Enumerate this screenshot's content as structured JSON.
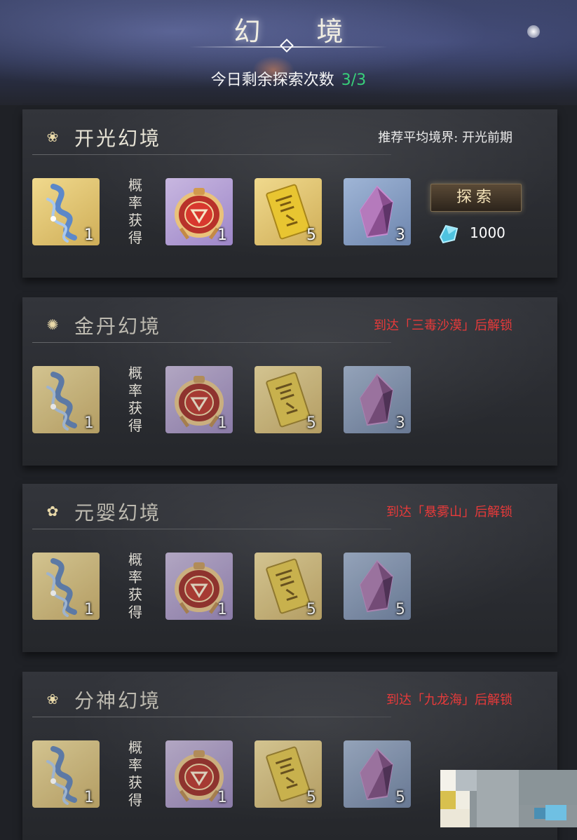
{
  "header": {
    "title": "幻 境",
    "explore_label": "今日剩余探索次数",
    "explore_value": "3/3"
  },
  "realms": [
    {
      "name": "开光幻境",
      "note": "推荐平均境界: 开光前期",
      "locked": false,
      "prob_label": "概率获得",
      "first_reward_count": "1",
      "drops": [
        "1",
        "5",
        "3"
      ],
      "explore_button": "探索",
      "cost": "1000"
    },
    {
      "name": "金丹幻境",
      "note": "到达「三毒沙漠」后解锁",
      "locked": true,
      "prob_label": "概率获得",
      "first_reward_count": "1",
      "drops": [
        "1",
        "5",
        "3"
      ]
    },
    {
      "name": "元婴幻境",
      "note": "到达「悬雾山」后解锁",
      "locked": true,
      "prob_label": "概率获得",
      "first_reward_count": "1",
      "drops": [
        "1",
        "5",
        "5"
      ]
    },
    {
      "name": "分神幻境",
      "note": "到达「九龙海」后解锁",
      "locked": true,
      "prob_label": "概率获得",
      "first_reward_count": "1",
      "drops": [
        "1",
        "5",
        "5"
      ]
    }
  ],
  "colors": {
    "count_green": "#38d07a",
    "lock_red": "#e83a3a",
    "gold_tile": "#f0d98d",
    "purple_tile": "#c8b7e0",
    "blue_tile": "#9fb5d6"
  },
  "icons": [
    "silk-ribbon-icon",
    "red-token-icon",
    "yellow-talisman-icon",
    "purple-crystal-icon",
    "spirit-stone-icon"
  ]
}
